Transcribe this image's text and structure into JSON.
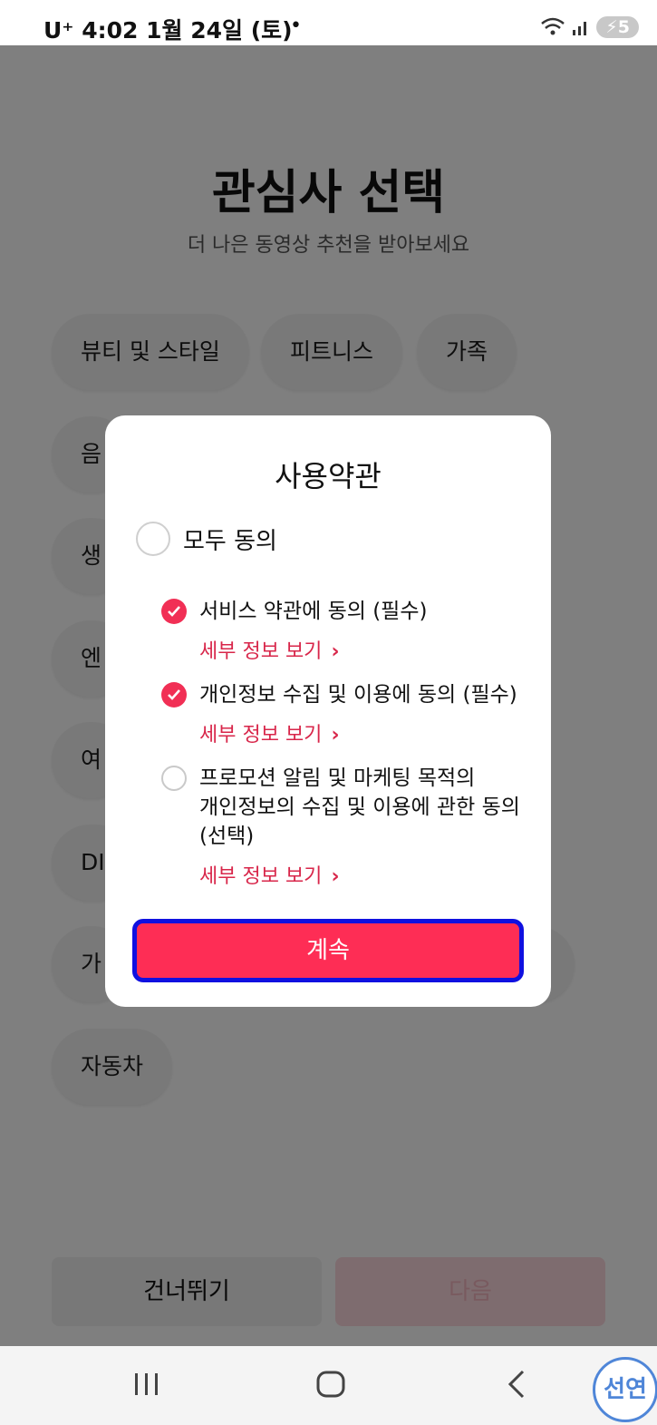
{
  "status_bar": {
    "carrier": "U⁺",
    "time_date": "4:02  1월 24일 (토)",
    "dot": "•",
    "battery": "5"
  },
  "page": {
    "title": "관심사 선택",
    "subtitle": "더 나은 동영상 추천을 받아보세요",
    "chips": [
      "뷰티 및 스타일",
      "피트니스",
      "가족",
      "음",
      "생",
      "엔",
      "여",
      "DI",
      "가",
      "자동차"
    ],
    "skip_label": "건너뛰기",
    "next_label": "다음"
  },
  "modal": {
    "title": "사용약관",
    "agree_all": "모두 동의",
    "items": [
      {
        "label": "서비스 약관에 동의 (필수)",
        "details": "세부 정보 보기",
        "checked": true
      },
      {
        "label": "개인정보 수집 및 이용에 동의 (필수)",
        "details": "세부 정보 보기",
        "checked": true
      },
      {
        "label_lines": [
          "프로모션 알림 및 마케팅 목적의",
          "개인정보의 수집 및 이용에 관한 동의",
          "(선택)"
        ],
        "details": "세부 정보 보기",
        "checked": false
      }
    ],
    "chevron": "›",
    "continue_label": "계속"
  },
  "nav_icons": [
    "recents-icon",
    "home-icon",
    "back-icon"
  ],
  "watermark": "선연",
  "colors": {
    "accent": "#fe2d55",
    "link": "#d8264a",
    "focus_border": "#1010e0"
  }
}
